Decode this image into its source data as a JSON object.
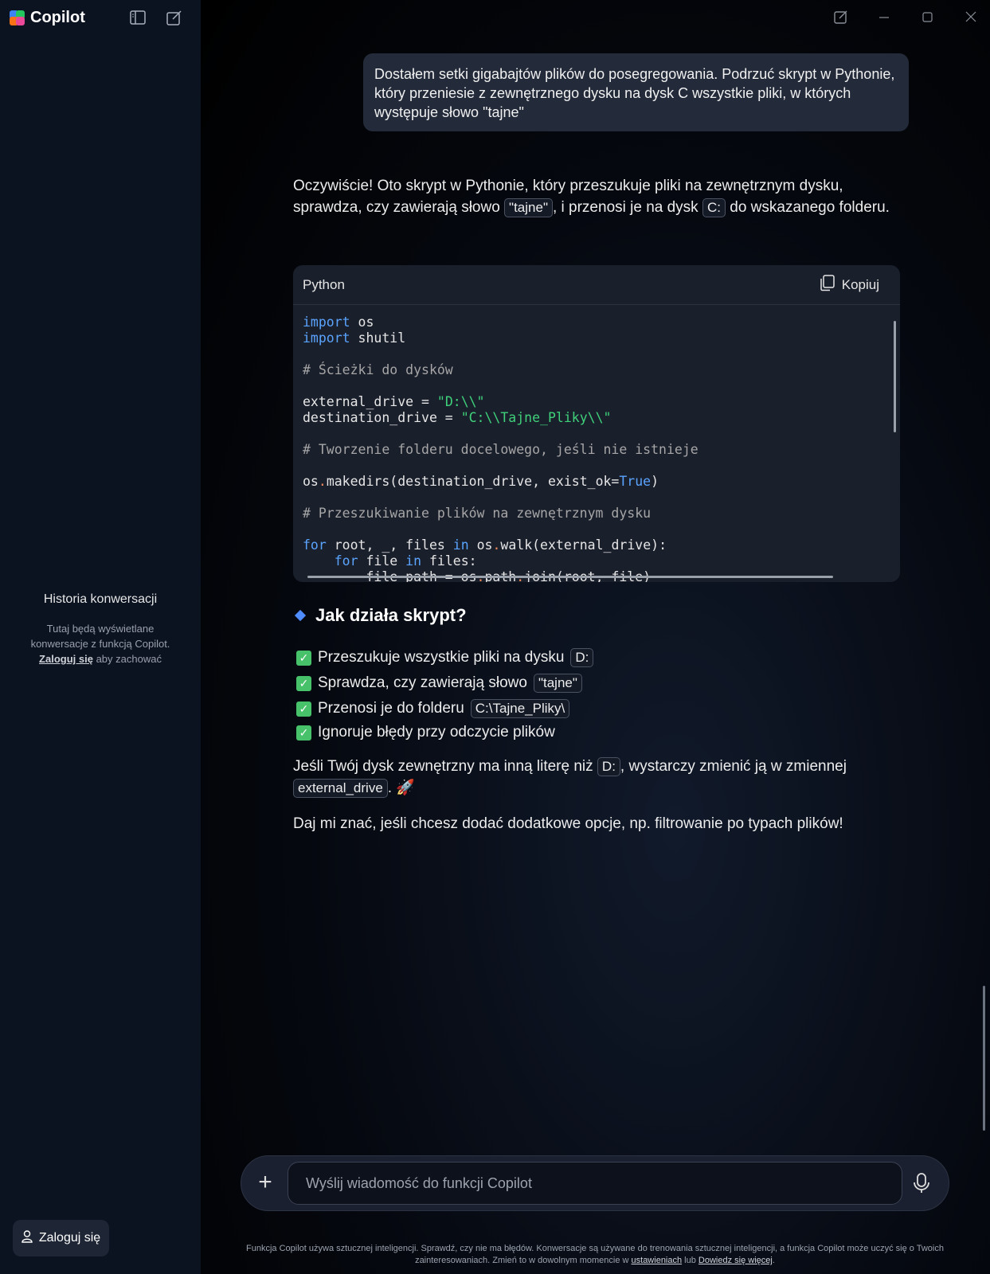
{
  "app": {
    "name": "Copilot"
  },
  "sidebar": {
    "history_title": "Historia konwersacji",
    "history_desc_1": "Tutaj będą wyświetlane konwersacje z funkcją Copilot.",
    "history_login_link": "Zaloguj się",
    "history_desc_2": "aby zachować",
    "login_button": "Zaloguj się"
  },
  "conversation": {
    "user_message": "Dostałem setki gigabajtów plików do posegregowania. Podrzuć skrypt w Pythonie, który przeniesie z zewnętrznego dysku na dysk C wszystkie pliki, w których występuje słowo \"tajne\"",
    "intro_1": "Oczywiście! Oto skrypt w Pythonie, który przeszukuje pliki na zewnętrznym dysku, sprawdza, czy zawierają słowo",
    "intro_chip_1": "\"tajne\"",
    "intro_2": ", i przenosi je na dysk",
    "intro_chip_2": "C:",
    "intro_3": " do wskazanego folderu.",
    "code": {
      "language": "Python",
      "copy_label": "Kopiuj",
      "lines": [
        "import os",
        "import shutil",
        "",
        "# Ścieżki do dysków",
        "",
        "external_drive = \"D:\\\\\"",
        "destination_drive = \"C:\\\\Tajne_Pliky\\\\\"",
        "",
        "# Tworzenie folderu docelowego, jeśli nie istnieje",
        "",
        "os.makedirs(destination_drive, exist_ok=True)",
        "",
        "# Przeszukiwanie plików na zewnętrznym dysku",
        "",
        "for root, _, files in os.walk(external_drive):",
        "    for file in files:",
        "        file_path = os.path.join(root, file)"
      ]
    },
    "section_title": "Jak działa skrypt?",
    "checks": [
      {
        "text": "Przeszukuje wszystkie pliki na dysku",
        "chip": "D:"
      },
      {
        "text": "Sprawdza, czy zawierają słowo",
        "chip": "\"tajne\""
      },
      {
        "text": "Przenosi je do folderu",
        "chip": "C:\\Tajne_Pliky\\"
      },
      {
        "text": "Ignoruje błędy przy odczycie plików",
        "chip": ""
      }
    ],
    "note_1": "Jeśli Twój dysk zewnętrzny ma inną literę niż",
    "note_chip_1": "D:",
    "note_2": ", wystarczy zmienić ją w zmiennej",
    "note_chip_2": "external_drive",
    "note_3": ". 🚀",
    "closing": "Daj mi znać, jeśli chcesz dodać dodatkowe opcje, np. filtrowanie po typach plików!"
  },
  "composer": {
    "placeholder": "Wyślij wiadomość do funkcji Copilot"
  },
  "footer": {
    "text_1": "Funkcja Copilot używa sztucznej inteligencji. Sprawdź, czy nie ma błędów. Konwersacje są używane do trenowania sztucznej inteligencji, a funkcja Copilot może uczyć się o Twoich zainteresowaniach. Zmień to w dowolnym momencie w",
    "link_1": "ustawieniach",
    "text_2": "lub",
    "link_2": "Dowiedz się więcej",
    "text_3": "."
  },
  "colors": {
    "accent": "#4e8cff",
    "check": "#47c26b",
    "keyword": "#5aa4ff",
    "string": "#3fd17a"
  },
  "icons": [
    "copilot-logo-icon",
    "sidebar-toggle-icon",
    "new-chat-icon",
    "popout-icon",
    "minimize-icon",
    "maximize-icon",
    "close-icon",
    "copy-icon",
    "person-icon",
    "plus-icon",
    "microphone-icon",
    "check-icon"
  ]
}
